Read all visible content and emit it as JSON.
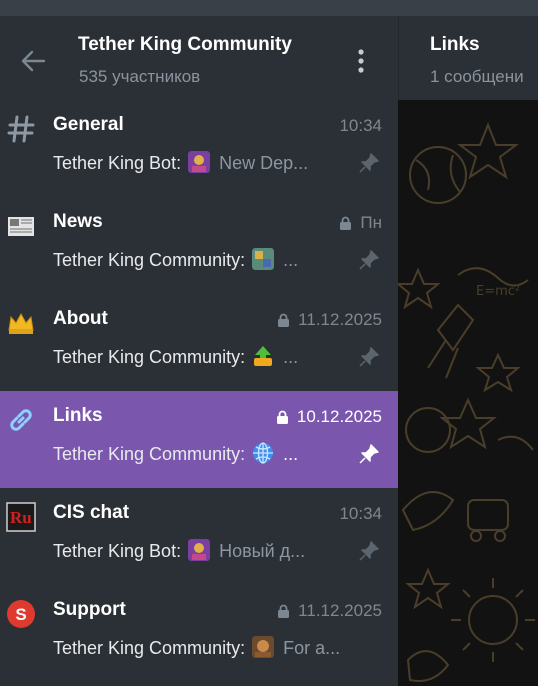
{
  "header": {
    "title": "Tether King Community",
    "subtitle": "535 участников"
  },
  "topics": [
    {
      "name": "General",
      "time": "10:34",
      "locked": false,
      "icon": "hash-icon",
      "sender": "Tether King Bot:",
      "text": "New Dep...",
      "emoji": "bot-avatar"
    },
    {
      "name": "News",
      "time": "Пн",
      "locked": true,
      "icon": "newspaper-icon",
      "sender": "Tether King Community:",
      "text": "...",
      "emoji": "image-thumb"
    },
    {
      "name": "About",
      "time": "11.12.2025",
      "locked": true,
      "icon": "crown-icon",
      "sender": "Tether King Community:",
      "text": "...",
      "emoji": "up-arrow-emoji"
    },
    {
      "name": "Links",
      "time": "10.12.2025",
      "locked": true,
      "icon": "link-icon",
      "sender": "Tether King Community:",
      "text": "...",
      "emoji": "globe-emoji",
      "active": true
    },
    {
      "name": "CIS chat",
      "time": "10:34",
      "locked": false,
      "icon": "ru-flag-icon",
      "sender": "Tether King Bot:",
      "text": "Новый д...",
      "emoji": "bot-avatar"
    },
    {
      "name": "Support",
      "time": "11.12.2025",
      "locked": true,
      "icon": "support-s-icon",
      "sender": "Tether King Community:",
      "text": "For a...",
      "emoji": "image-thumb"
    }
  ],
  "right_panel": {
    "title": "Links",
    "subtitle": "1 сообщени"
  },
  "colors": {
    "active": "#7a56ad",
    "sidebar": "#2b3036",
    "chat_bg": "#121212"
  }
}
